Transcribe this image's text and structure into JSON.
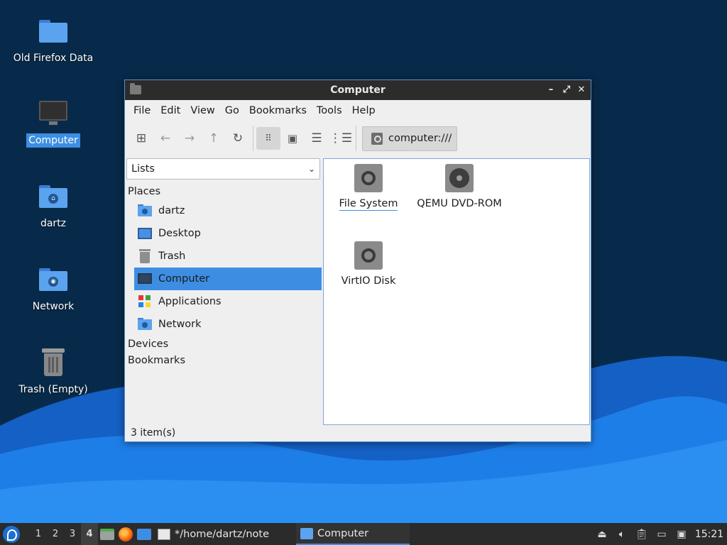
{
  "desktop": {
    "icons": [
      {
        "label": "Old Firefox Data",
        "kind": "folder"
      },
      {
        "label": "Computer",
        "kind": "computer",
        "selected": true
      },
      {
        "label": "dartz",
        "kind": "home-folder"
      },
      {
        "label": "Network",
        "kind": "network-folder"
      },
      {
        "label": "Trash (Empty)",
        "kind": "trash"
      }
    ]
  },
  "window": {
    "title": "Computer",
    "buttons": {
      "minimize": "–",
      "maximize": "⤢",
      "close": "✕"
    },
    "menu": [
      "File",
      "Edit",
      "View",
      "Go",
      "Bookmarks",
      "Tools",
      "Help"
    ],
    "toolbar": {
      "icons": [
        "new-tab-icon",
        "back-icon",
        "forward-icon",
        "up-icon",
        "reload-icon",
        "icon-view-icon",
        "thumbnail-view-icon",
        "compact-view-icon",
        "detailed-list-view-icon"
      ],
      "location": "computer:///"
    },
    "side": {
      "mode": "Lists",
      "places_header": "Places",
      "places": [
        {
          "label": "dartz",
          "icon": "home-folder-icon"
        },
        {
          "label": "Desktop",
          "icon": "desktop-icon"
        },
        {
          "label": "Trash",
          "icon": "trash-icon"
        },
        {
          "label": "Computer",
          "icon": "computer-icon",
          "selected": true
        },
        {
          "label": "Applications",
          "icon": "applications-icon"
        },
        {
          "label": "Network",
          "icon": "network-folder-icon"
        }
      ],
      "devices_header": "Devices",
      "bookmarks_header": "Bookmarks"
    },
    "items": [
      {
        "label": "File System",
        "icon": "drive-icon",
        "focused": true
      },
      {
        "label": "QEMU DVD-ROM",
        "icon": "optical-drive-icon"
      },
      {
        "label": "VirtIO Disk",
        "icon": "drive-icon"
      }
    ],
    "status": "3 item(s)"
  },
  "taskbar": {
    "workspaces": [
      "1",
      "2",
      "3",
      "4"
    ],
    "active_workspace": "4",
    "tasks": [
      {
        "label": "*/home/dartz/note",
        "icon": "text-editor-icon"
      },
      {
        "label": "Computer",
        "icon": "folder-icon",
        "active": true
      }
    ],
    "clock": "15:21"
  },
  "colors": {
    "accent": "#3d8ee3",
    "titlebar": "#2c2c2c",
    "taskbar": "#2b2b2b",
    "desktop_dark": "#082a4a",
    "wave": "#1e7ee8"
  }
}
